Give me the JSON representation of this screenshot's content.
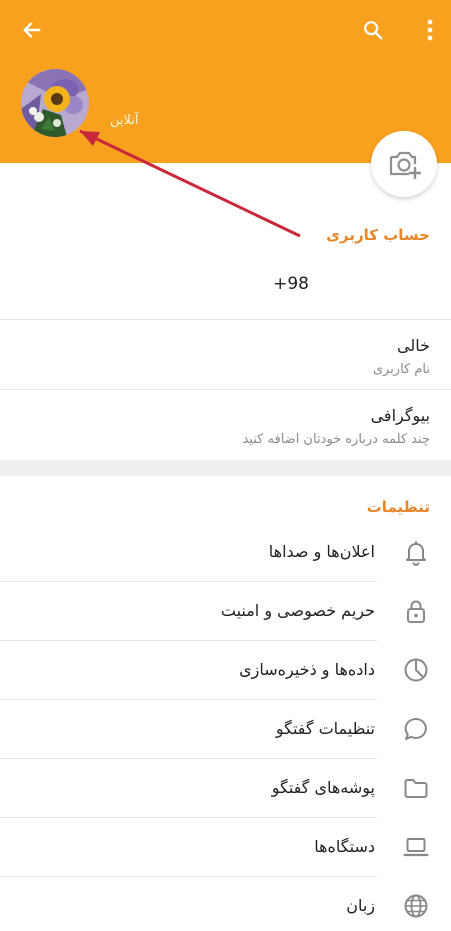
{
  "header": {
    "back_icon": "arrow-left-icon",
    "search_icon": "search-icon",
    "more_icon": "more-vertical-icon",
    "status": "آنلاین",
    "camera_icon": "camera-add-icon",
    "background": "#f8a11f"
  },
  "account": {
    "title": "حساب کاربری",
    "phone": "+98",
    "username_value": "خالی",
    "username_label": "نام کاربری",
    "bio_title": "بیوگرافی",
    "bio_hint": "چند کلمه درباره خودتان اضافه کنید"
  },
  "settings": {
    "title": "تنظیمات",
    "items": [
      {
        "label": "اعلان‌ها و صداها",
        "icon": "bell-icon"
      },
      {
        "label": "حریم خصوصی و امنیت",
        "icon": "lock-icon"
      },
      {
        "label": "داده‌ها و ذخیره‌سازی",
        "icon": "pie-chart-icon"
      },
      {
        "label": "تنظیمات گفتگو",
        "icon": "chat-bubble-icon"
      },
      {
        "label": "پوشه‌های گفتگو",
        "icon": "folder-icon"
      },
      {
        "label": "دستگاه‌ها",
        "icon": "laptop-icon"
      },
      {
        "label": "زبان",
        "icon": "globe-icon"
      }
    ]
  },
  "colors": {
    "accent": "#e8862a",
    "arrow": "#c8283a"
  }
}
